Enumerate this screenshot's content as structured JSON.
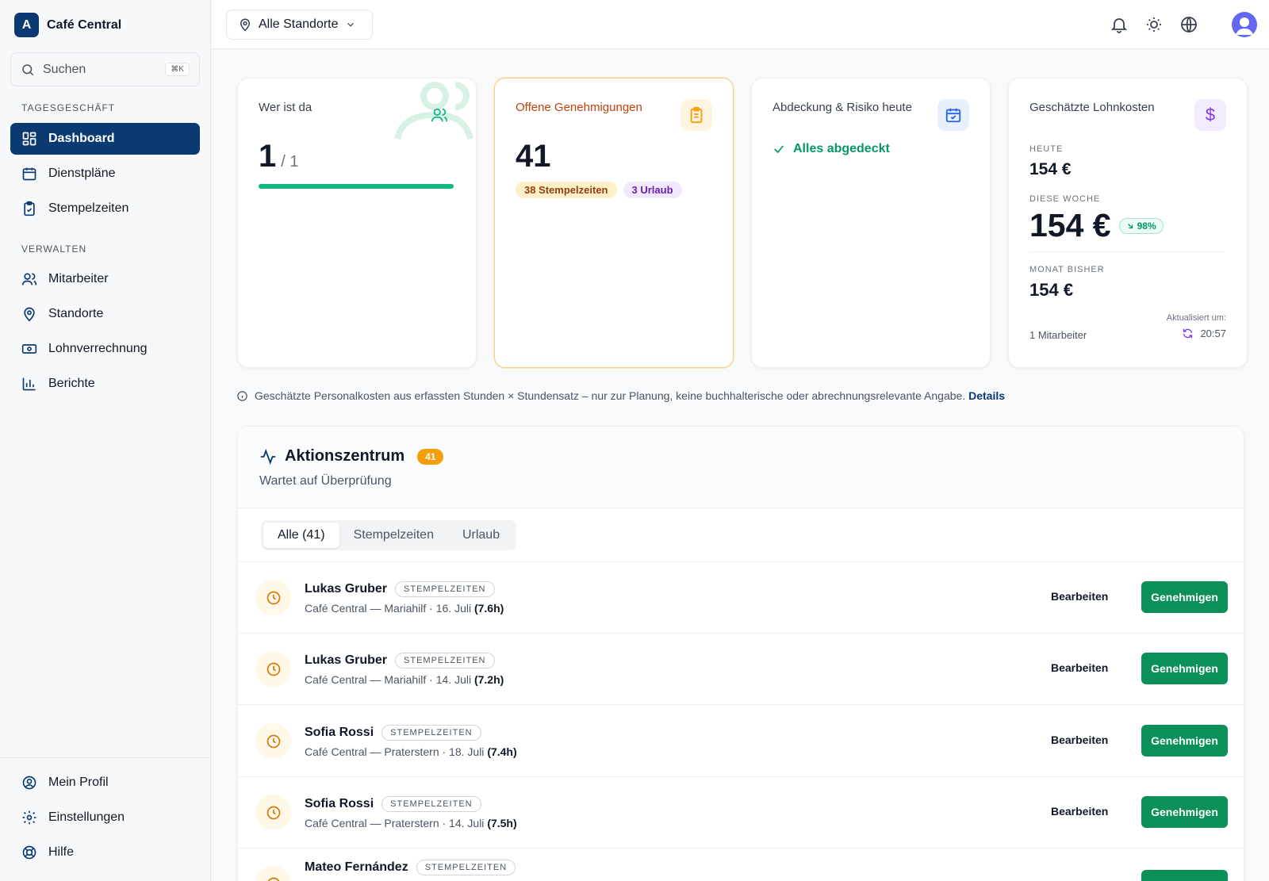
{
  "brand": {
    "logo_letter": "A",
    "name": "Café Central"
  },
  "search": {
    "label": "Suchen",
    "shortcut": "⌘K"
  },
  "sidebar": {
    "section_daily": "TAGESGESCHÄFT",
    "section_manage": "VERWALTEN",
    "items": [
      {
        "label": "Dashboard",
        "icon": "dashboard-icon",
        "active": true
      },
      {
        "label": "Dienstpläne",
        "icon": "calendar-icon"
      },
      {
        "label": "Stempelzeiten",
        "icon": "clipboard-check-icon"
      },
      {
        "label": "Mitarbeiter",
        "icon": "users-icon"
      },
      {
        "label": "Standorte",
        "icon": "map-pin-icon"
      },
      {
        "label": "Lohnverrechnung",
        "icon": "banknote-icon"
      },
      {
        "label": "Berichte",
        "icon": "bar-chart-icon"
      }
    ],
    "footer": [
      {
        "label": "Mein Profil",
        "icon": "user-circle-icon"
      },
      {
        "label": "Einstellungen",
        "icon": "gear-icon"
      },
      {
        "label": "Hilfe",
        "icon": "lifebuoy-icon"
      }
    ]
  },
  "topbar": {
    "location": "Alle Standorte",
    "icons": [
      "bell-icon",
      "sun-icon",
      "globe-icon",
      "avatar"
    ]
  },
  "cards": {
    "present": {
      "title": "Wer ist da",
      "value": "1",
      "total": "/ 1",
      "progress": 1.0
    },
    "approvals": {
      "title": "Offene Genehmigungen",
      "value": "41",
      "pill_time": "38 Stempelzeiten",
      "pill_leave": "3 Urlaub"
    },
    "coverage": {
      "title": "Abdeckung & Risiko heute",
      "status": "Alles abgedeckt"
    },
    "costs": {
      "title": "Geschätzte Lohnkosten",
      "today_label": "HEUTE",
      "today_value": "154 €",
      "week_label": "DIESE WOCHE",
      "week_value": "154 €",
      "week_change": "98%",
      "month_label": "MONAT BISHER",
      "month_value": "154 €",
      "employees": "1 Mitarbeiter",
      "updated_label": "Aktualisiert um:",
      "updated_time": "20:57"
    }
  },
  "info": {
    "text": "Geschätzte Personalkosten aus erfassten Stunden × Stundensatz – nur zur Planung, keine buchhalterische oder abrechnungsrelevante Angabe.",
    "link": "Details"
  },
  "action_center": {
    "title": "Aktionszentrum",
    "count": "41",
    "subtitle": "Wartet auf Überprüfung",
    "tabs": [
      "Alle (41)",
      "Stempelzeiten",
      "Urlaub"
    ],
    "edit_label": "Bearbeiten",
    "approve_label": "Genehmigen",
    "rows": [
      {
        "name": "Lukas Gruber",
        "tag": "STEMPELZEITEN",
        "meta": "Café Central — Mariahilf · 16. Juli",
        "hours": "(7.6h)"
      },
      {
        "name": "Lukas Gruber",
        "tag": "STEMPELZEITEN",
        "meta": "Café Central — Mariahilf · 14. Juli",
        "hours": "(7.2h)"
      },
      {
        "name": "Sofia Rossi",
        "tag": "STEMPELZEITEN",
        "meta": "Café Central — Praterstern · 18. Juli",
        "hours": "(7.4h)"
      },
      {
        "name": "Sofia Rossi",
        "tag": "STEMPELZEITEN",
        "meta": "Café Central — Praterstern · 14. Juli",
        "hours": "(7.5h)"
      },
      {
        "name": "Mateo Fernández",
        "tag": "STEMPELZEITEN",
        "meta": "",
        "hours": ""
      }
    ]
  },
  "colors": {
    "primary": "#0b3a73",
    "success": "#0a9058",
    "warning": "#f59e0b",
    "accent_purple": "#7c3aed"
  }
}
